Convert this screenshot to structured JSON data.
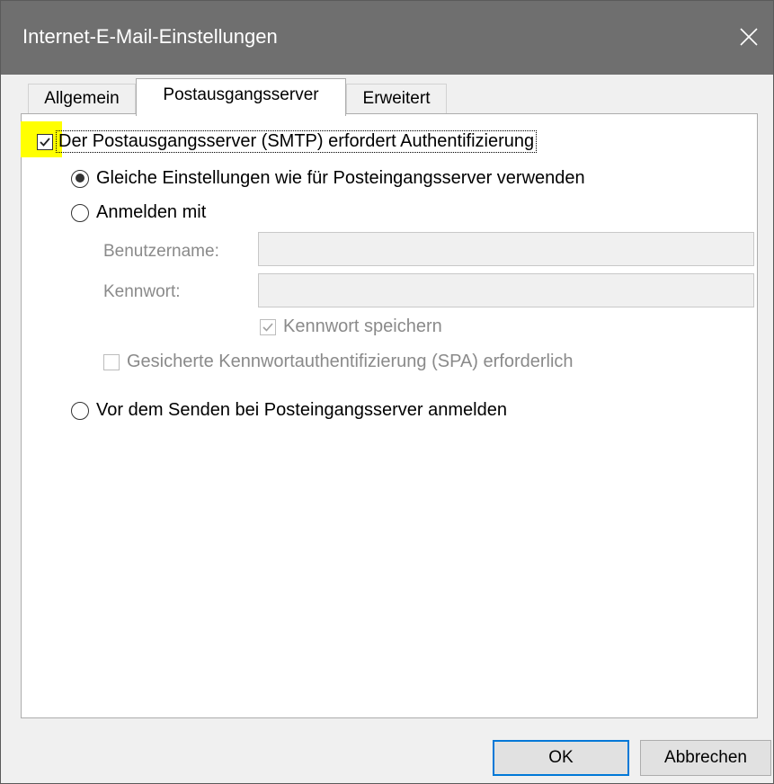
{
  "window": {
    "title": "Internet-E-Mail-Einstellungen"
  },
  "tabs": [
    {
      "label": "Allgemein",
      "active": false
    },
    {
      "label": "Postausgangsserver",
      "active": true
    },
    {
      "label": "Erweitert",
      "active": false
    }
  ],
  "smtp_auth": {
    "label": "Der Postausgangsserver (SMTP) erfordert Authentifizierung",
    "checked": true
  },
  "options": {
    "same_settings": {
      "label": "Gleiche Einstellungen wie für Posteingangsserver verwenden",
      "selected": true
    },
    "login_with": {
      "label": "Anmelden mit",
      "selected": false
    },
    "login_before_send": {
      "label": "Vor dem Senden bei Posteingangsserver anmelden",
      "selected": false
    }
  },
  "credentials": {
    "username_label": "Benutzername:",
    "username_value": "",
    "password_label": "Kennwort:",
    "password_value": "",
    "remember_password": {
      "label": "Kennwort speichern",
      "checked": true,
      "disabled": true
    },
    "spa": {
      "label": "Gesicherte Kennwortauthentifizierung (SPA) erforderlich",
      "checked": false,
      "disabled": true
    }
  },
  "buttons": {
    "ok": "OK",
    "cancel": "Abbrechen"
  },
  "colors": {
    "titlebar": "#6f6f6f",
    "highlight": "#ffff00",
    "default_button_border": "#0078d7"
  },
  "icons": [
    "close-icon",
    "checkmark-icon"
  ]
}
